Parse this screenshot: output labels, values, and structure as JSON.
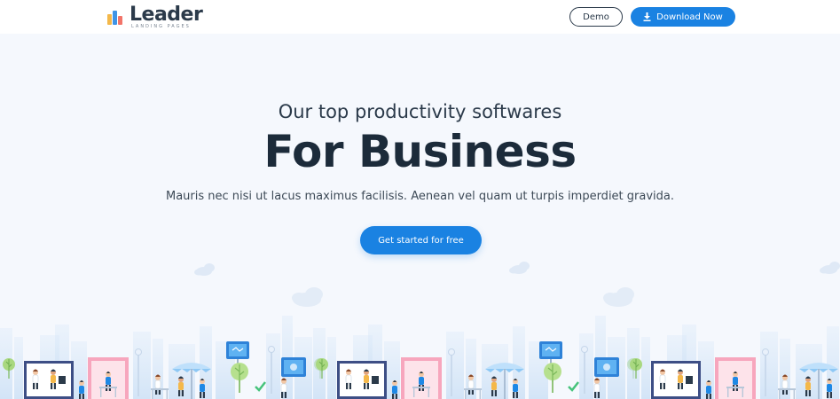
{
  "header": {
    "logo": {
      "name": "Leader",
      "tagline": "LANDING PAGES"
    },
    "demo_label": "Demo",
    "download_label": "Download Now"
  },
  "hero": {
    "subtitle": "Our top productivity softwares",
    "title": "For Business",
    "description": "Mauris nec nisi ut lacus maximus facilisis. Aenean vel quam ut turpis imperdiet gravida.",
    "cta_label": "Get started for free"
  },
  "colors": {
    "accent": "#1a82e2",
    "heading": "#1c2b3a",
    "background": "#f5f8fd"
  },
  "icons": [
    "bar-chart-logo-icon",
    "download-icon"
  ]
}
